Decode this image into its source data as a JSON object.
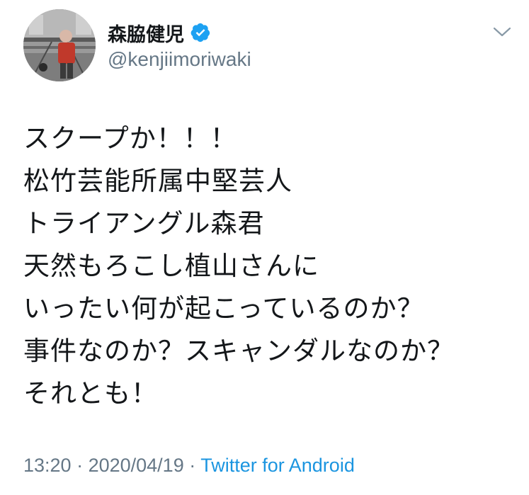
{
  "author": {
    "display_name": "森脇健児",
    "handle": "@kenjiimoriwaki",
    "verified": true
  },
  "tweet": {
    "lines": [
      "スクープか！！！",
      "松竹芸能所属中堅芸人",
      "トライアングル森君",
      "天然もろこし植山さんに",
      "いったい何が起こっているのか？",
      "事件なのか？スキャンダルなのか？",
      "それとも！"
    ],
    "time": "13:20",
    "separator1": " · ",
    "date": "2020/04/19",
    "separator2": " · ",
    "source": "Twitter for Android"
  },
  "icons": {
    "verified": "verified-badge-icon",
    "more": "chevron-down-icon",
    "avatar": "profile-photo"
  },
  "colors": {
    "text": "#14171a",
    "secondary": "#657786",
    "link": "#1b95e0",
    "verified": "#1da1f2",
    "background": "#ffffff"
  }
}
